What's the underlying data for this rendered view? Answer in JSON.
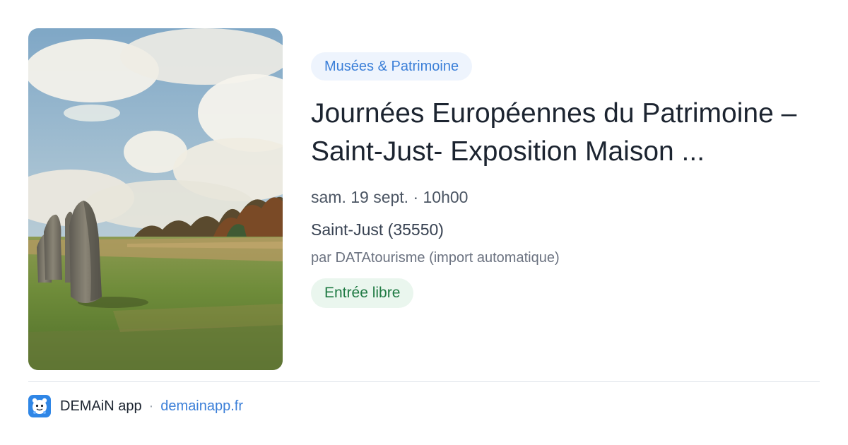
{
  "event": {
    "category": "Musées & Patrimoine",
    "title": "Journées Européennes du Patrimoine – Saint-Just- Exposition Maison ...",
    "datetime": "sam. 19 sept. · 10h00",
    "location": "Saint-Just (35550)",
    "source": "par DATAtourisme (import automatique)",
    "price": "Entrée libre",
    "image": "standing-stones-photo"
  },
  "footer": {
    "app_name": "DEMAiN app",
    "separator": "·",
    "link": "demainapp.fr",
    "icon": "demain-app-icon"
  },
  "colors": {
    "accent": "#3b7fd8",
    "category_bg": "#eef4fd",
    "price_text": "#1f7a43",
    "price_bg": "#eaf6ee",
    "title": "#1c2430"
  }
}
